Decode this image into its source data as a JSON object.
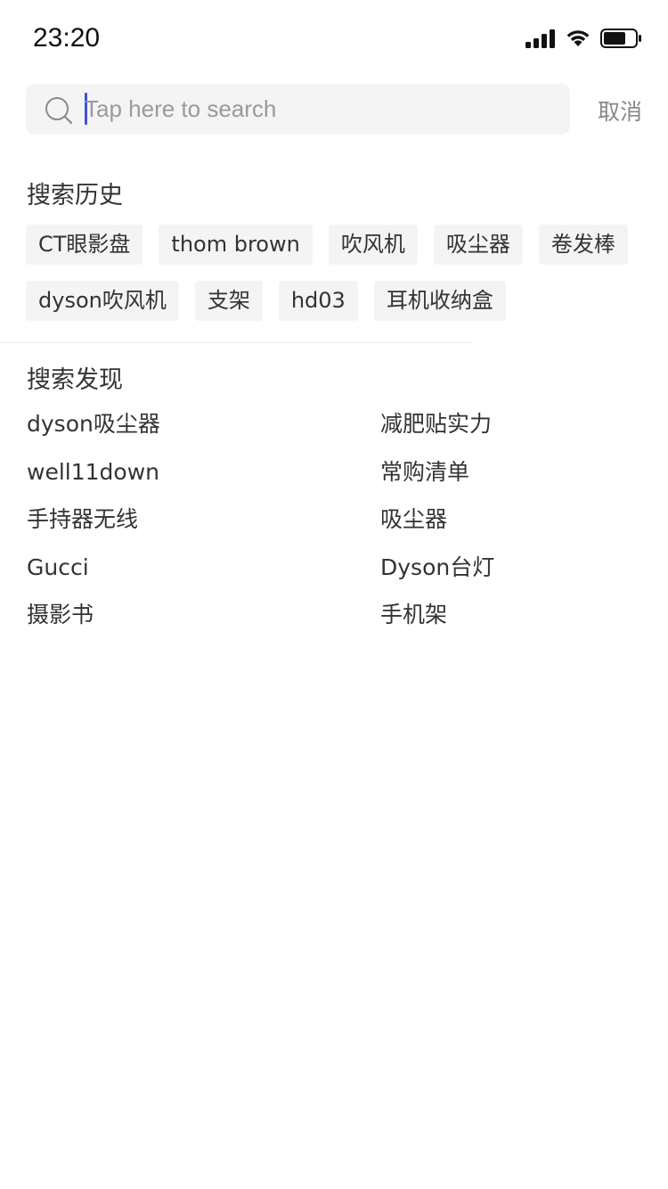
{
  "status_bar": {
    "time": "23:20"
  },
  "search": {
    "placeholder": "Tap here to search",
    "value": "",
    "cancel_label": "取消"
  },
  "history": {
    "title": "搜索历史",
    "items": [
      "CT眼影盘",
      "thom brown",
      "吹风机",
      "吸尘器",
      "卷发棒",
      "dyson吹风机",
      "支架",
      "hd03",
      "耳机收纳盒"
    ]
  },
  "discover": {
    "title": "搜索发现",
    "items": [
      "dyson吸尘器",
      "减肥贴实力",
      "well11down",
      "常购清单",
      "手持器无线",
      "吸尘器",
      "Gucci",
      "Dyson台灯",
      "摄影书",
      "手机架"
    ]
  },
  "colors": {
    "accent_caret": "#3f51d6",
    "chip_bg": "#f4f4f4",
    "muted_text": "#888888"
  }
}
